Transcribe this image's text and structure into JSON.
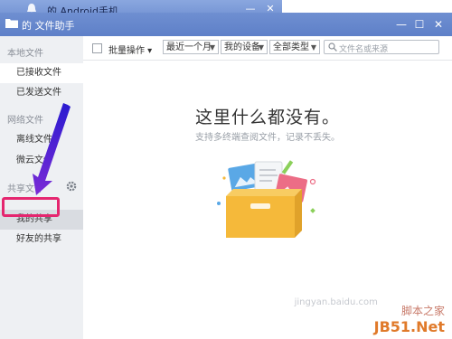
{
  "background_window": {
    "title": "的 Android手机",
    "minimize": "—",
    "close": "✕"
  },
  "window": {
    "title": "的 文件助手",
    "min": "—",
    "max": "☐",
    "close": "✕"
  },
  "sidebar": {
    "local_section": "本地文件",
    "local_items": [
      {
        "label": "已接收文件"
      },
      {
        "label": "已发送文件"
      }
    ],
    "network_section": "网络文件",
    "network_items": [
      {
        "label": "离线文件"
      },
      {
        "label": "微云文件"
      }
    ],
    "share_section": "共享文件",
    "share_items": [
      {
        "label": "我的共享"
      },
      {
        "label": "好友的共享"
      }
    ]
  },
  "toolbar": {
    "bulk_action": "批量操作",
    "time_filter": "最近一个月",
    "device_filter": "我的设备",
    "type_filter": "全部类型",
    "search_placeholder": "文件名或来源"
  },
  "empty_state": {
    "title": "这里什么都没有。",
    "subtitle": "支持多终端查阅文件，记录不丢失。"
  },
  "watermark": {
    "site": "脚本之家",
    "domain": "JB51.Net",
    "faint": "jingyan.baidu.com"
  },
  "colors": {
    "titlebar": "#6f8fd1",
    "arrow": "#4b1ec8",
    "highlight": "#e5266f",
    "folder": "#f5b93a"
  }
}
